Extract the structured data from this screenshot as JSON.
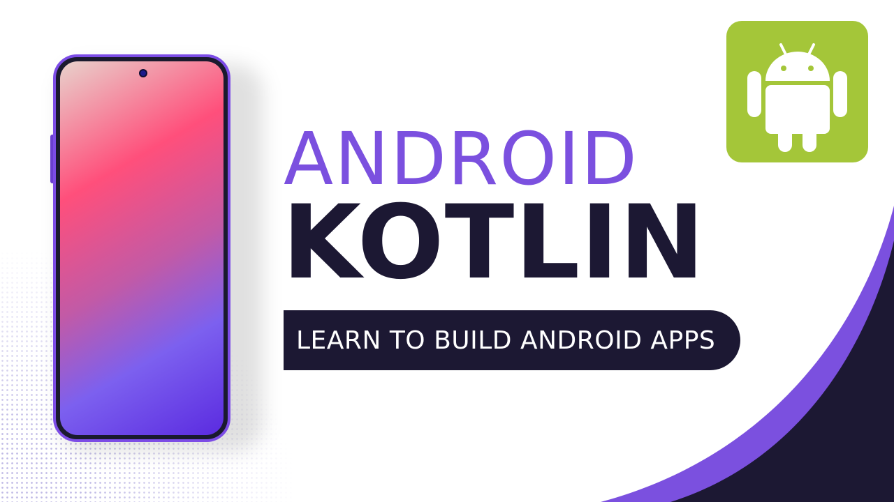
{
  "headline": {
    "line1": "ANDROID",
    "line2": "KOTLIN"
  },
  "tagline": "LEARN TO BUILD ANDROID APPS",
  "badge": {
    "icon": "android-robot-icon"
  },
  "colors": {
    "accent_purple": "#7b50df",
    "navy": "#1c1833",
    "android_green": "#a4c639"
  }
}
